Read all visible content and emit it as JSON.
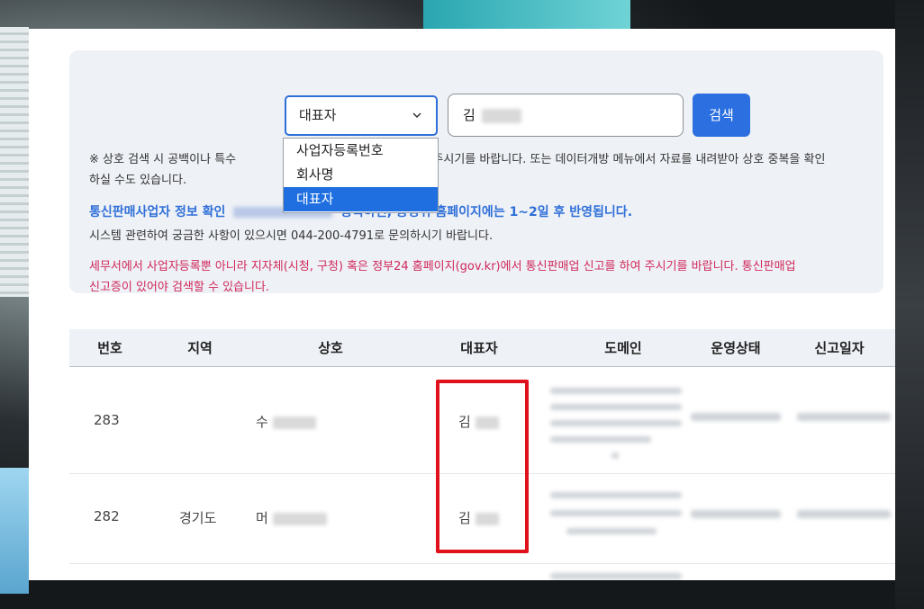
{
  "search": {
    "select_value": "대표자",
    "query_value": "김",
    "button_label": "검색",
    "options": [
      "사업자등록번호",
      "회사명",
      "대표자"
    ],
    "selected_option": "대표자"
  },
  "notices": {
    "general_prefix": "※ 상호 검색 시 공백이나 특수",
    "general_suffix": "입력해 주시기를 바랍니다. 또는 데이터개방 메뉴에서 자료를 내려받아 상호 중복을 확인",
    "general_line2": "하실 수도 있습니다.",
    "blue_prefix": "통신판매사업자 정보 확인",
    "blue_suffix": "등록하면, 공정위 홈페이지에는 1~2일 후 반영됩니다.",
    "system": "시스템 관련하여 궁금한 사항이 있으시면 044-200-4791로 문의하시기 바랍니다.",
    "red_line1": "세무서에서 사업자등록뿐 아니라 지자체(시청, 구청) 혹은 정부24 홈페이지(gov.kr)에서 통신판매업 신고를 하여 주시기를 바랍니다. 통신판매업",
    "red_line2": "신고증이 있어야 검색할 수 있습니다."
  },
  "table": {
    "headers": [
      "번호",
      "지역",
      "상호",
      "대표자",
      "도메인",
      "운영상태",
      "신고일자"
    ],
    "rows": [
      {
        "no": "283",
        "region": "",
        "name_prefix": "수",
        "rep_prefix": "김"
      },
      {
        "no": "282",
        "region": "경기도",
        "name_prefix": "머",
        "rep_prefix": "김"
      }
    ]
  },
  "colors": {
    "accent": "#2b6fe0",
    "panel": "#eef1f6",
    "notice_red": "#d0285a",
    "highlight": "#e0111a"
  },
  "icons": {
    "select_chevron": "chevron-down-icon"
  }
}
